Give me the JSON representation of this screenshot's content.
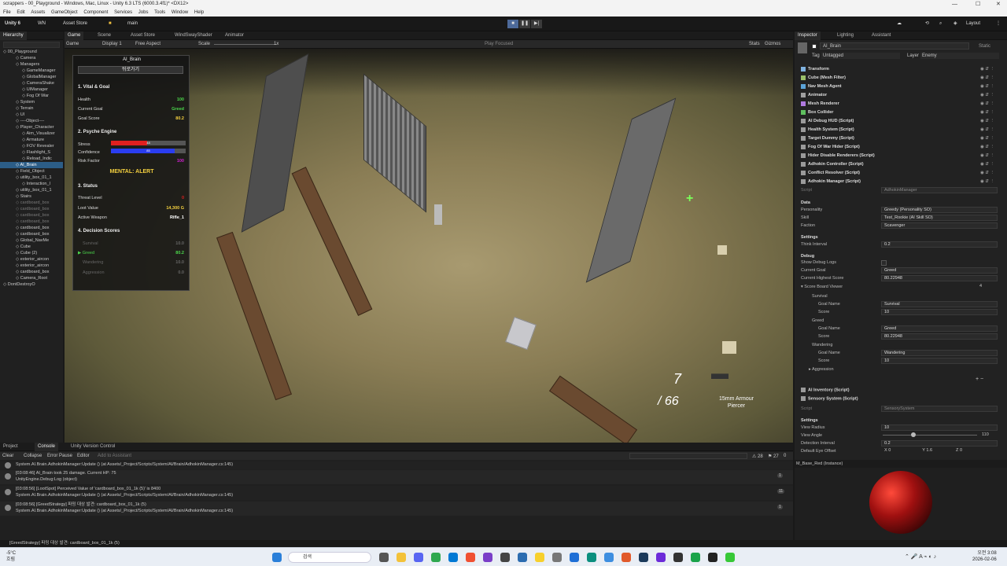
{
  "titlebar": {
    "title": "scrappers - 00_Playground - Windows, Mac, Linux - Unity 6.3 LTS (6000.3.4f1)* <DX12>"
  },
  "menu": [
    "File",
    "Edit",
    "Assets",
    "GameObject",
    "Component",
    "Services",
    "Jobs",
    "Tools",
    "Window",
    "Help"
  ],
  "toolbar": {
    "account": "Unity 6",
    "wn": "WN",
    "asset_store": "Asset Store",
    "branch": "main",
    "layout": "Layout"
  },
  "hierarchy": {
    "tab": "Hierarchy",
    "items": [
      {
        "label": "00_Playground",
        "grey": false,
        "sel": false
      },
      {
        "label": "Camera",
        "grey": false,
        "sel": false
      },
      {
        "label": "Managers",
        "grey": false,
        "sel": false
      },
      {
        "label": "GameManager",
        "grey": false,
        "sel": false
      },
      {
        "label": "GlobalManager",
        "grey": false,
        "sel": false
      },
      {
        "label": "CameraShake",
        "grey": false,
        "sel": false
      },
      {
        "label": "UIManager",
        "grey": false,
        "sel": false
      },
      {
        "label": "Fog Of War",
        "grey": false,
        "sel": false
      },
      {
        "label": "System",
        "grey": false,
        "sel": false
      },
      {
        "label": "Terrain",
        "grey": false,
        "sel": false
      },
      {
        "label": "UI",
        "grey": false,
        "sel": false
      },
      {
        "label": "----Object----",
        "grey": false,
        "sel": false
      },
      {
        "label": "Player_Character",
        "grey": false,
        "sel": false
      },
      {
        "label": "Aim_Visualizer",
        "grey": false,
        "sel": false
      },
      {
        "label": "Armature",
        "grey": false,
        "sel": false
      },
      {
        "label": "FOV Revealer",
        "grey": false,
        "sel": false
      },
      {
        "label": "Flashlight_S",
        "grey": false,
        "sel": false
      },
      {
        "label": "Reload_Indic",
        "grey": false,
        "sel": false
      },
      {
        "label": "AI_Brain",
        "grey": false,
        "sel": true
      },
      {
        "label": "Field_Object",
        "grey": false,
        "sel": false
      },
      {
        "label": "utility_box_01_1",
        "grey": false,
        "sel": false
      },
      {
        "label": "Interaction_I",
        "grey": false,
        "sel": false
      },
      {
        "label": "utility_box_01_1",
        "grey": false,
        "sel": false
      },
      {
        "label": "Stairs",
        "grey": false,
        "sel": false
      },
      {
        "label": "cardboard_box",
        "grey": true,
        "sel": false
      },
      {
        "label": "cardboard_box",
        "grey": true,
        "sel": false
      },
      {
        "label": "cardboard_box",
        "grey": true,
        "sel": false
      },
      {
        "label": "cardboard_box",
        "grey": true,
        "sel": false
      },
      {
        "label": "cardboard_box",
        "grey": false,
        "sel": false
      },
      {
        "label": "cardboard_box",
        "grey": false,
        "sel": false
      },
      {
        "label": "Global_NavMe",
        "grey": false,
        "sel": false
      },
      {
        "label": "Cube",
        "grey": false,
        "sel": false
      },
      {
        "label": "Cube (2)",
        "grey": false,
        "sel": false
      },
      {
        "label": "exterior_aircon",
        "grey": false,
        "sel": false
      },
      {
        "label": "exterior_aircon",
        "grey": false,
        "sel": false
      },
      {
        "label": "cardboard_box",
        "grey": false,
        "sel": false
      },
      {
        "label": "Camera_Root",
        "grey": false,
        "sel": false
      },
      {
        "label": "DontDestroyO",
        "grey": false,
        "sel": false
      }
    ]
  },
  "scene_tabs": [
    "Game",
    "Scene",
    "Asset Store",
    "WindSwayShader",
    "Animator"
  ],
  "game_bar": {
    "game": "Game",
    "display": "Display 1",
    "aspect": "Free Aspect",
    "scale_label": "Scale",
    "scale_value": "1x",
    "play_focused": "Play Focused",
    "stats": "Stats",
    "gizmos": "Gizmos"
  },
  "hud": {
    "name": "AI_Brain",
    "back_button": "뒤로가기",
    "s1": "1. Vital & Goal",
    "health_label": "Health",
    "health": "100",
    "goal_label": "Current Goal",
    "goal": "Greed",
    "goal_score_label": "Goal Score",
    "goal_score": "80.2",
    "s2": "2. Psyche Engine",
    "stress_label": "Stress",
    "stress": "48",
    "confidence_label": "Confidence",
    "confidence": "85",
    "risk_label": "Risk Factor",
    "risk": "100",
    "mental": "MENTAL: ALERT",
    "s3": "3. Status",
    "threat_label": "Threat Level",
    "threat": "0",
    "loot_label": "Loot Value",
    "loot": "14,300 G",
    "weapon_label": "Active Weapon",
    "weapon": "Rifle_1",
    "s4": "4. Decision Scores",
    "scores": [
      {
        "label": "Survival",
        "value": "10.0",
        "active": false
      },
      {
        "label": "Greed",
        "value": "80.2",
        "active": true
      },
      {
        "label": "Wandering",
        "value": "10.0",
        "active": false
      },
      {
        "label": "Aggression",
        "value": "0.0",
        "active": false
      }
    ],
    "active_marker": "▶"
  },
  "ammo": {
    "current": "7",
    "total": "/ 66",
    "weapon_name": "15mm Armour Piercer"
  },
  "inspector": {
    "tabs": [
      "Inspector",
      "Lighting",
      "Assistant"
    ],
    "object_name": "AI_Brain",
    "static": "Static",
    "tag_label": "Tag",
    "tag": "Untagged",
    "layer_label": "Layer",
    "layer": "Enemy",
    "components": [
      "Transform",
      "Cube (Mesh Filter)",
      "Nav Mesh Agent",
      "Animator",
      "Mesh Renderer",
      "Box Collider",
      "AI Debug HUD (Script)",
      "Health System (Script)",
      "Target Dummy (Script)",
      "Fog Of War Hider (Script)",
      "Hider Disable Renderers (Script)",
      "Adhokin Controller (Script)",
      "Conflict Resolver (Script)",
      "Adhokin Manager (Script)"
    ],
    "script_label": "Script",
    "script_value": "AdhokinManager",
    "data_header": "Data",
    "personality_label": "Personality",
    "personality": "Greedy (Personality SO)",
    "skill_label": "Skill",
    "skill": "Test_Rookie (AI Skill SO)",
    "faction_label": "Faction",
    "faction": "Scavenger",
    "settings_header": "Settings",
    "think_label": "Think Interval",
    "think": "0.2",
    "debug_header": "Debug",
    "show_debug_label": "Show Debug Logs",
    "cur_goal_label": "Current Goal",
    "cur_goal": "Greed",
    "cur_high_label": "Current Highest Score",
    "cur_high": "80.22948",
    "scoreboard_label": "Score Board Viewer",
    "scoreboard_count": "4",
    "sb": [
      {
        "name": "Survival",
        "goal_label": "Goal Name",
        "goal": "Survival",
        "score_label": "Score",
        "score": "10"
      },
      {
        "name": "Greed",
        "goal_label": "Goal Name",
        "goal": "Greed",
        "score_label": "Score",
        "score": "80.22948"
      },
      {
        "name": "Wandering",
        "goal_label": "Goal Name",
        "goal": "Wandering",
        "score_label": "Score",
        "score": "10"
      }
    ],
    "aggression": "Aggression",
    "ai_inventory": "AI Inventory (Script)",
    "sensory": "Sensory System (Script)",
    "sensory_script": "SensorySystem",
    "sensory_settings": "Settings",
    "view_radius_label": "View Radius",
    "view_radius": "10",
    "view_angle_label": "View Angle",
    "view_angle": "110",
    "detect_label": "Detection Interval",
    "detect": "0.2",
    "eye_label": "Default Eye Offset",
    "eye_x_label": "X",
    "eye_x": "0",
    "eye_y_label": "Y",
    "eye_y": "1.6",
    "eye_z_label": "Z",
    "eye_z": "0",
    "material": "M_Base_Red (Instance)"
  },
  "console": {
    "tabs": [
      "Project",
      "Console",
      "Unity Version Control"
    ],
    "buttons": [
      "Clear",
      "Collapse",
      "Error Pause",
      "Editor"
    ],
    "search_placeholder": "Add to Assistant",
    "count_warn": "28",
    "count_err": "27",
    "count_info": "0",
    "rows": [
      {
        "l1": "System.AI.Brain.AdhokinManager:Update () (at Assets/_Project/Scripts/System/AI/Brain/AdhokinManager.cs:145)",
        "l2": "",
        "count": ""
      },
      {
        "l1": "[03:08:46] AI_Brain took 25 damage. Current HP: 75",
        "l2": "UnityEngine.Debug:Log (object)",
        "count": "1"
      },
      {
        "l1": "[03:08:56] [LootSpot] Perceived Value of 'cardboard_box_01_1k (5)' is 8400",
        "l2": "System.AI.Brain.AdhokinManager:Update () (at Assets/_Project/Scripts/System/AI/Brain/AdhokinManager.cs:145)",
        "count": "11"
      },
      {
        "l1": "[03:08:56] [GreedStrategy] 파밍 대상 발견: cardboard_box_01_1k (5)",
        "l2": "System.AI.Brain.AdhokinManager:Update () (at Assets/_Project/Scripts/System/AI/Brain/AdhokinManager.cs:145)",
        "count": "1"
      }
    ],
    "status": "[GreedStrategy] 파밍 대상 발견: cardboard_box_01_1k (5)"
  },
  "taskbar": {
    "weather": "-5°C",
    "weather2": "흐림",
    "search": "검색",
    "time": "오전 3:08",
    "date": "2026-02-06"
  },
  "colors": {
    "accent": "#2c5d87",
    "green": "#4bd64b",
    "yellow": "#f4d03f",
    "red": "#e02020",
    "blue": "#2a3df0",
    "magenta": "#d020d0"
  }
}
